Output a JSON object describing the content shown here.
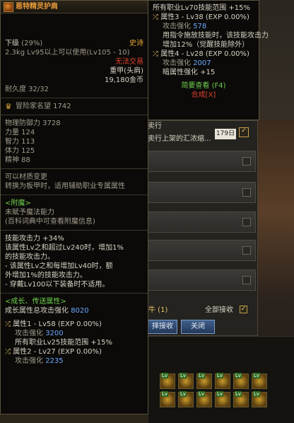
{
  "main": {
    "title": "恩特精灵护肩",
    "grade": "下级",
    "grade_pct": "(29%)",
    "rarity": "史诗",
    "weight_level": "2.3kg  Lv95以上可以使用(Lv105 - 10)",
    "trade": "无法交易",
    "slot": "重甲(头肩)",
    "price": "19,180金币",
    "durability": "耐久度 32/32",
    "adventure_fame": "冒险家名望 1742",
    "stats": [
      "物理防御力 3728",
      "力量 124",
      "智力 113",
      "体力 125",
      "精神 88"
    ],
    "material_change": "可以材质变更",
    "convert": "转换为板甲时，适用辅助职业专属属性",
    "enchant_header": "<附魔>",
    "enchant_none": "未赋予魔法能力",
    "enchant_hint": "(百科词典中可查看附魔信息)",
    "skill_attack": "技能攻击力 +34%",
    "desc_lines": [
      "该属性Lv之和超过Lv240时，增加1%",
      "的技能攻击力。",
      "- 该属性Lv之和每增加Lv40时，额",
      "外增加1%的技能攻击力。",
      "- 穿戴Lv100以下装备时不适用。"
    ],
    "growth_header": "<成长、传送属性>",
    "growth_total_label": "成长属性总攻击强化",
    "growth_total_value": "8020",
    "attr1_title": "属性1 - Lv58 (EXP 0.00%)",
    "attr1_atk_label": "攻击强化",
    "attr1_atk_value": "3200",
    "attr1_range": "所有职业Lv25技能范围 +15%",
    "attr2_title": "属性2 - Lv27 (EXP 0.00%)",
    "attr2_atk_label": "攻击强化",
    "attr2_atk_value": "2235"
  },
  "sub": {
    "range_line": "所有职业Lv70技能范围 +15%",
    "attr3_title": "属性3 - Lv38 (EXP 0.00%)",
    "attr3_atk_label": "攻击强化",
    "attr3_atk_value": "578",
    "attr3_desc1": "用指令施放技能时，该技能攻击力",
    "attr3_desc2": "增加12%（觉醒技能除外）",
    "attr4_title": "属性4 - Lv28 (EXP 0.00%)",
    "attr4_atk_label": "攻击强化",
    "attr4_atk_value": "2007",
    "attr4_dark": "暗属性强化 +15",
    "brief_view": "简要查看 (F4)",
    "synth": "合成[X]"
  },
  "mail": {
    "title": "卖行",
    "subtitle": "卖行上架的汇浓缩...",
    "days": "179日",
    "count": "牛 (1)",
    "receive_all": "全部接收",
    "select_receive": "择接收",
    "close": "关闭"
  },
  "colors": {
    "title": "#e99a3a",
    "epic": "#e8a83a",
    "untradable": "#e0402c",
    "value_blue": "#6aa9ff",
    "enchant_green": "#6fcf4e"
  }
}
